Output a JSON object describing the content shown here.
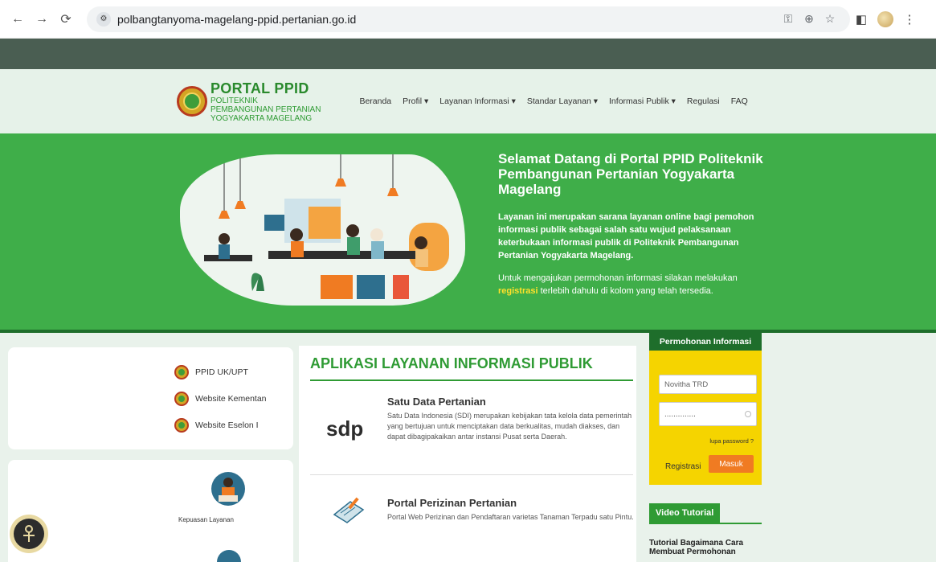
{
  "browser": {
    "url": "polbangtanyoma-magelang-ppid.pertanian.go.id"
  },
  "header": {
    "logo_title": "PORTAL PPID",
    "logo_line1": "POLITEKNIK",
    "logo_line2": "PEMBANGUNAN PERTANIAN",
    "logo_line3": "YOGYAKARTA MAGELANG",
    "nav": [
      {
        "label": "Beranda"
      },
      {
        "label": "Profil ▾"
      },
      {
        "label": "Layanan Informasi ▾"
      },
      {
        "label": "Standar Layanan ▾"
      },
      {
        "label": "Informasi Publik ▾"
      },
      {
        "label": "Regulasi"
      },
      {
        "label": "FAQ"
      }
    ]
  },
  "hero": {
    "title": "Selamat Datang di Portal PPID Politeknik Pembangunan Pertanian Yogyakarta Magelang",
    "bold_text": "Layanan ini merupakan sarana layanan online bagi pemohon informasi publik sebagai salah satu wujud pelaksanaan keterbukaan informasi publik di Politeknik Pembangunan Pertanian Yogyakarta Magelang.",
    "text_before": "Untuk mengajukan permohonan informasi silakan melakukan ",
    "highlight": "registrasi",
    "text_after": " terlebih dahulu di kolom yang telah tersedia."
  },
  "links": [
    {
      "label": "PPID UK/UPT"
    },
    {
      "label": "Website Kementan"
    },
    {
      "label": "Website Eselon I"
    }
  ],
  "survey": {
    "label": "Kepuasan Layanan"
  },
  "apps": {
    "title": "APLIKASI LAYANAN INFORMASI PUBLIK",
    "items": [
      {
        "name": "Satu Data Pertanian",
        "logo_text": "sdp",
        "desc": "Satu Data Indonesia (SDI) merupakan kebijakan tata kelola data pemerintah yang bertujuan untuk menciptakan data berkualitas, mudah diakses, dan dapat dibagipakaikan antar instansi Pusat serta Daerah."
      },
      {
        "name": "Portal Perizinan Pertanian",
        "desc": "Portal Web Perizinan dan Pendaftaran varietas Tanaman Terpadu satu Pintu."
      }
    ]
  },
  "form": {
    "title": "Permohonan Informasi",
    "username_value": "Novitha TRD",
    "password_value": "..............",
    "forgot": "lupa password ?",
    "register": "Registrasi",
    "login": "Masuk"
  },
  "video": {
    "title": "Video Tutorial",
    "desc": "Tutorial Bagaimana Cara Membuat Permohonan"
  },
  "colors": {
    "brand_green": "#3fae49",
    "dark_green": "#1e6e2b",
    "accent_yellow": "#f5d400",
    "accent_orange": "#f07b22"
  }
}
